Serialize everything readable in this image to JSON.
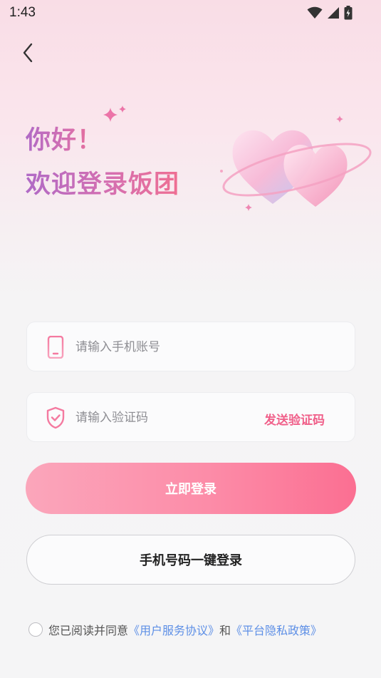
{
  "status_bar": {
    "time": "1:43"
  },
  "header": {
    "greeting_line1": "你好！",
    "greeting_line2": "欢迎登录饭团"
  },
  "form": {
    "phone_placeholder": "请输入手机账号",
    "code_placeholder": "请输入验证码",
    "send_code_label": "发送验证码",
    "login_label": "立即登录",
    "one_key_login_label": "手机号码一键登录"
  },
  "agreement": {
    "prefix": "您已阅读并同意",
    "user_agreement": "《用户服务协议》",
    "and": "和",
    "privacy_policy": "《平台隐私政策》"
  },
  "colors": {
    "accent": "#f0608a",
    "link": "#5d8fe6",
    "button_gradient_start": "#fba6bb",
    "button_gradient_end": "#fb6f92"
  },
  "icons": [
    "wifi-icon",
    "signal-icon",
    "battery-icon",
    "back-arrow-icon",
    "phone-icon",
    "shield-check-icon",
    "hearts-illustration",
    "sparkle-icon"
  ]
}
